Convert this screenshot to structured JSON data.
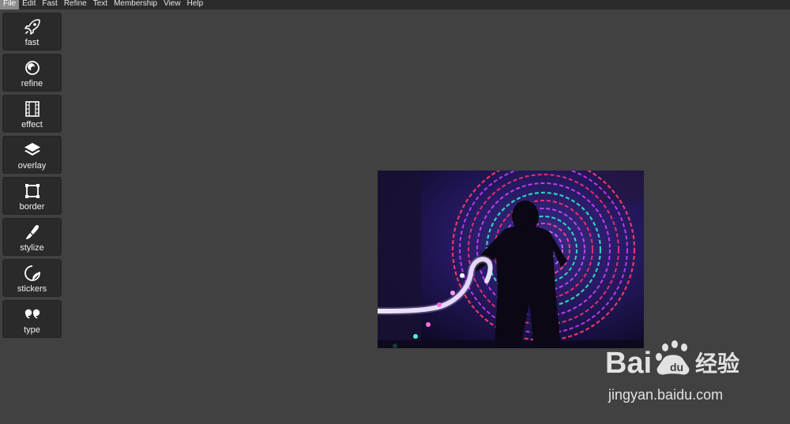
{
  "menubar": {
    "items": [
      {
        "label": "File",
        "active": true
      },
      {
        "label": "Edit"
      },
      {
        "label": "Fast"
      },
      {
        "label": "Refine"
      },
      {
        "label": "Text"
      },
      {
        "label": "Membership"
      },
      {
        "label": "View"
      },
      {
        "label": "Help"
      }
    ]
  },
  "sidebar": {
    "tools": [
      {
        "label": "fast",
        "icon": "rocket-icon"
      },
      {
        "label": "refine",
        "icon": "refine-icon"
      },
      {
        "label": "effect",
        "icon": "film-icon"
      },
      {
        "label": "overlay",
        "icon": "layers-icon"
      },
      {
        "label": "border",
        "icon": "border-icon"
      },
      {
        "label": "stylize",
        "icon": "brush-icon"
      },
      {
        "label": "stickers",
        "icon": "sticker-icon"
      },
      {
        "label": "type",
        "icon": "quote-icon"
      }
    ]
  },
  "canvas": {
    "image": "light-painting-photo",
    "watermark": {
      "logo": "Bai 经验",
      "url": "jingyan.baidu.com"
    }
  },
  "colors": {
    "app_bg": "#414141",
    "menubar_bg": "#2b2b2b",
    "tool_bg": "#2a2a2a"
  }
}
